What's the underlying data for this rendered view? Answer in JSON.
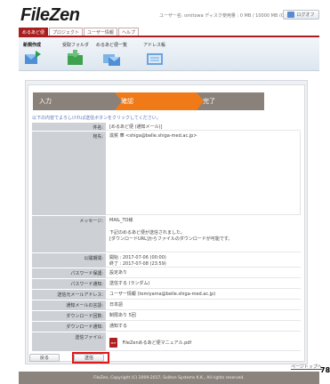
{
  "app": {
    "logo": "FileZen",
    "user_info": "ユーザー名: omitowa  ディスク使用量 : 0 MB / 10000 MB (0%)",
    "logout_label": "ログオフ"
  },
  "tabs": [
    {
      "label": "めるあど便"
    },
    {
      "label": "プロジェクト"
    },
    {
      "label": "ユーザー情報"
    },
    {
      "label": "ヘルプ"
    }
  ],
  "toolbar": [
    {
      "label": "新規作成",
      "icon": "new-send-icon"
    },
    {
      "label": "受取フォルダ",
      "icon": "received-folder-icon"
    },
    {
      "label": "めるあど便一覧",
      "icon": "send-list-icon"
    },
    {
      "label": "アドレス帳",
      "icon": "address-book-icon"
    }
  ],
  "steps": {
    "input": "入力",
    "confirm": "確認",
    "done": "完了"
  },
  "note": "以下の内容でよろしければ送信ボタンをクリックしてください。",
  "form": {
    "subject_label": "件名:",
    "subject_value": "[めるあど便 (通知メール)]",
    "to_label": "宛先:",
    "to_value": "滋賀 華 <shiga@belle.shiga-med.ac.jp>",
    "message_label": "メッセージ:",
    "message_lines": [
      "MAIL_TO様",
      "",
      "下記のめるあど便が送信されました。",
      "[ダウンロードURL]からファイルのダウンロードが可能です。"
    ],
    "period_label": "公開期間:",
    "period_lines": [
      "開始 : 2017-07-06 (00:00)",
      "終了 : 2017-07-08 (23:59)"
    ],
    "pw_label": "パスワード保護:",
    "pw_value": "設定あり",
    "pw_notify_label": "パスワード通知:",
    "pw_notify_value": "送信する (ランダム)",
    "sender_label": "送信元メールアドレス:",
    "sender_value": "ユーザー情報 (tomiyama@belle.shiga-med.ac.jp)",
    "lang_label": "通知メールの言語:",
    "lang_value": "日本語",
    "dl_limit_label": "ダウンロード回数:",
    "dl_limit_value": "制限あり 5回",
    "dl_notify_label": "ダウンロード通知:",
    "dl_notify_value": "通知する",
    "file_label": "送信ファイル:",
    "file_value": "FileZenめるあど便マニュアル.pdf"
  },
  "buttons": {
    "back": "戻る",
    "send": "送信"
  },
  "mini_link": "ページトップへ",
  "footer": "FileZen, Copyright (C) 2009-2017, Soliton Systems K.K., All rights reserved.",
  "page_number": "78"
}
